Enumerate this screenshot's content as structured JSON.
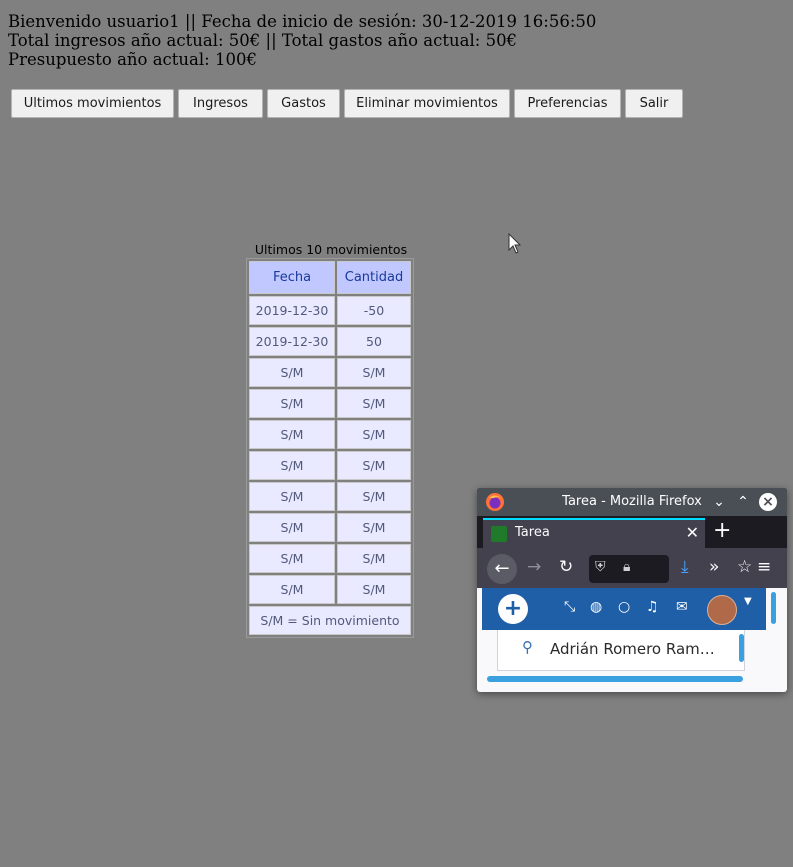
{
  "header": {
    "line1": "Bienvenido usuario1 || Fecha de inicio de sesión: 30-12-2019 16:56:50",
    "line2": "Total ingresos año actual: 50€ || Total gastos año actual: 50€",
    "line3": "Presupuesto año actual: 100€"
  },
  "nav": [
    "Ultimos movimientos",
    "Ingresos",
    "Gastos",
    "Eliminar movimientos",
    "Preferencias",
    "Salir"
  ],
  "table": {
    "caption": "Ultimos 10 movimientos",
    "headers": [
      "Fecha",
      "Cantidad"
    ],
    "rows": [
      [
        "2019-12-30",
        "-50"
      ],
      [
        "2019-12-30",
        "50"
      ],
      [
        "S/M",
        "S/M"
      ],
      [
        "S/M",
        "S/M"
      ],
      [
        "S/M",
        "S/M"
      ],
      [
        "S/M",
        "S/M"
      ],
      [
        "S/M",
        "S/M"
      ],
      [
        "S/M",
        "S/M"
      ],
      [
        "S/M",
        "S/M"
      ],
      [
        "S/M",
        "S/M"
      ]
    ],
    "footer": "S/M = Sin movimiento"
  },
  "firefox": {
    "window_title": "Tarea - Mozilla Firefox",
    "tab_title": "Tarea",
    "user_name": "Adrián Romero Ram…",
    "accent": "#1f5fa8"
  },
  "colors": {
    "background": "#808080",
    "header_cell": "#c0c8ff",
    "body_cell": "#e9e9ff"
  }
}
